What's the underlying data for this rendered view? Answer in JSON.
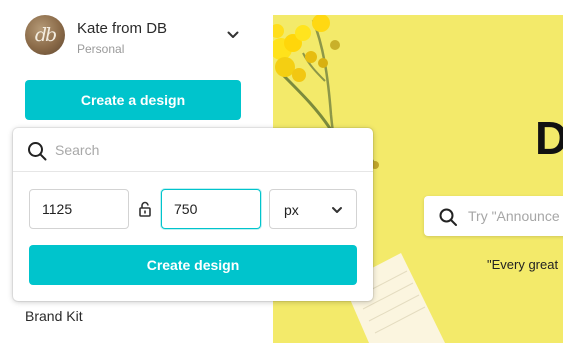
{
  "account": {
    "avatar_initials": "db",
    "name": "Kate from DB",
    "type": "Personal"
  },
  "sidebar": {
    "create_design_label": "Create a design",
    "brand_kit_label": "Brand Kit"
  },
  "popover": {
    "search_placeholder": "Search",
    "width_value": "1125",
    "height_value": "750",
    "unit_value": "px",
    "create_label": "Create design"
  },
  "hero": {
    "heading_fragment": "D",
    "search_placeholder": "Try \"Announce",
    "quote_fragment": "\"Every great"
  },
  "colors": {
    "accent": "#00c4cc",
    "hero_background": "#f3ea6a"
  },
  "icons": [
    "chevron-down-icon",
    "search-icon",
    "lock-icon"
  ]
}
